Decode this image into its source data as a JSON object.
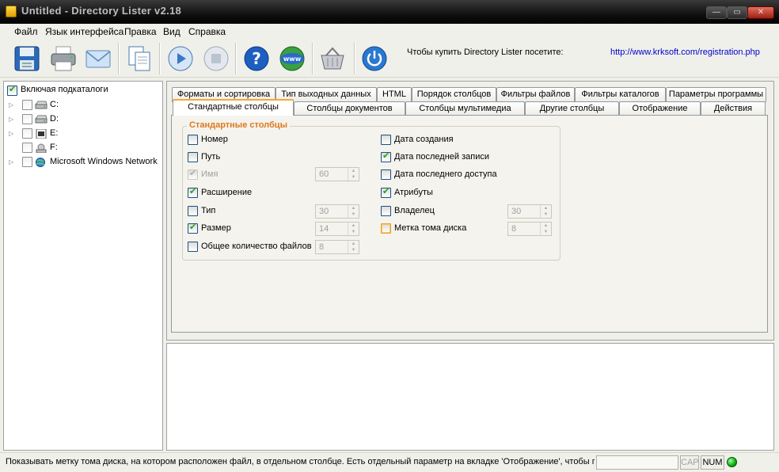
{
  "window": {
    "title": "Untitled - Directory Lister v2.18",
    "min": "—",
    "max": "▭",
    "close": "✕"
  },
  "menu": [
    "Файл",
    "Язык интерфейса",
    "Правка",
    "Вид",
    "Справка"
  ],
  "toolbar": {
    "buttons": [
      "save-icon",
      "print-icon",
      "email-icon",
      "copy-icon",
      "play-icon",
      "stop-icon",
      "help-icon",
      "www-icon",
      "basket-icon",
      "power-icon"
    ],
    "promo_text": "Чтобы купить Directory Lister посетите:",
    "promo_link": "http://www.krksoft.com/registration.php"
  },
  "tree": {
    "include_subfolders": {
      "label": "Включая подкаталоги",
      "checked": true
    },
    "drives": [
      {
        "label": "C:",
        "icon": "hard-drive-icon"
      },
      {
        "label": "D:",
        "icon": "hard-drive-icon"
      },
      {
        "label": "E:",
        "icon": "cd-drive-icon"
      },
      {
        "label": "F:",
        "icon": "removable-drive-icon"
      },
      {
        "label": "Microsoft Windows Network",
        "icon": "network-icon"
      }
    ]
  },
  "tabs": {
    "row1": [
      "Форматы и сортировка",
      "Тип выходных данных",
      "HTML",
      "Порядок столбцов",
      "Фильтры файлов",
      "Фильтры каталогов",
      "Параметры программы"
    ],
    "row2": [
      "Стандартные столбцы",
      "Столбцы документов",
      "Столбцы мультимедиа",
      "Другие столбцы",
      "Отображение",
      "Действия"
    ],
    "active": "Стандартные столбцы"
  },
  "group": {
    "title": "Стандартные столбцы",
    "left": [
      {
        "label": "Номер",
        "checked": false
      },
      {
        "label": "Путь",
        "checked": false
      },
      {
        "label": "Имя",
        "checked": true,
        "disabled": true,
        "spin": "60"
      },
      {
        "label": "Расширение",
        "checked": true
      },
      {
        "label": "Тип",
        "checked": false,
        "spin": "30"
      },
      {
        "label": "Размер",
        "checked": true,
        "spin": "14"
      },
      {
        "label": "Общее количество файлов",
        "checked": false,
        "spin": "8"
      }
    ],
    "right": [
      {
        "label": "Дата создания",
        "checked": false
      },
      {
        "label": "Дата последней записи",
        "checked": true
      },
      {
        "label": "Дата последнего доступа",
        "checked": false
      },
      {
        "label": "Атрибуты",
        "checked": true
      },
      {
        "label": "Владелец",
        "checked": false,
        "spin": "30"
      },
      {
        "label": "Метка тома диска",
        "checked": false,
        "focused": true,
        "spin": "8"
      }
    ]
  },
  "status": {
    "text": "Показывать метку тома диска, на котором расположен файл, в отдельном столбце. Есть отдельный параметр на вкладке  'Отображение', чтобы по",
    "cap": "CAP",
    "num": "NUM"
  }
}
